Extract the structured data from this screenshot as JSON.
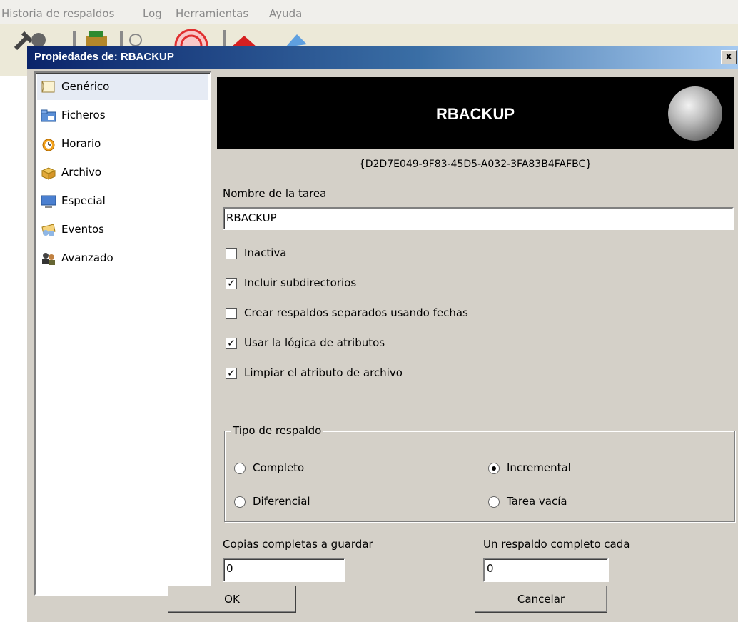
{
  "menubar": {
    "items": [
      "Historia de respaldos",
      "Log",
      "Herramientas",
      "Ayuda"
    ]
  },
  "toolbar": {
    "icons": [
      "tools-icon",
      "package-icon",
      "magnifier-icon",
      "target-icon",
      "house-icon",
      "arrow-icon"
    ]
  },
  "dialog": {
    "title": "Propiedades de: RBACKUP",
    "close_label": "x"
  },
  "sidebar": {
    "items": [
      {
        "label": "Genérico",
        "icon": "document-icon",
        "selected": true
      },
      {
        "label": "Ficheros",
        "icon": "folder-icon",
        "selected": false
      },
      {
        "label": "Horario",
        "icon": "alarm-clock-icon",
        "selected": false
      },
      {
        "label": "Archivo",
        "icon": "archive-box-icon",
        "selected": false
      },
      {
        "label": "Especial",
        "icon": "monitor-icon",
        "selected": false
      },
      {
        "label": "Eventos",
        "icon": "events-icon",
        "selected": false
      },
      {
        "label": "Avanzado",
        "icon": "users-icon",
        "selected": false
      }
    ]
  },
  "banner": {
    "title": "RBACKUP",
    "guid": "{D2D7E049-9F83-45D5-A032-3FA83B4FAFBC}"
  },
  "form": {
    "task_name_label": "Nombre de la tarea",
    "task_name_value": "RBACKUP",
    "checkboxes": [
      {
        "label": "Inactiva",
        "checked": false
      },
      {
        "label": "Incluir subdirectorios",
        "checked": true
      },
      {
        "label": "Crear respaldos separados usando fechas",
        "checked": false
      },
      {
        "label": "Usar la lógica de atributos",
        "checked": true
      },
      {
        "label": "Limpiar el atributo de archivo",
        "checked": true
      }
    ],
    "check_mark": "✓",
    "backup_type": {
      "legend": "Tipo de respaldo",
      "options": [
        {
          "label": "Completo",
          "selected": false
        },
        {
          "label": "Incremental",
          "selected": true
        },
        {
          "label": "Diferencial",
          "selected": false
        },
        {
          "label": "Tarea vacía",
          "selected": false
        }
      ]
    },
    "full_copies_label": "Copias completas a guardar",
    "full_copies_value": "0",
    "full_every_label": "Un respaldo completo cada",
    "full_every_value": "0"
  },
  "buttons": {
    "ok_label": "OK",
    "cancel_label": "Cancelar"
  },
  "colors": {
    "title_gradient_start": "#0a246a",
    "title_gradient_end": "#a6caf0",
    "dialog_face": "#d4d0c8",
    "selected_item": "#e6ebf4"
  }
}
